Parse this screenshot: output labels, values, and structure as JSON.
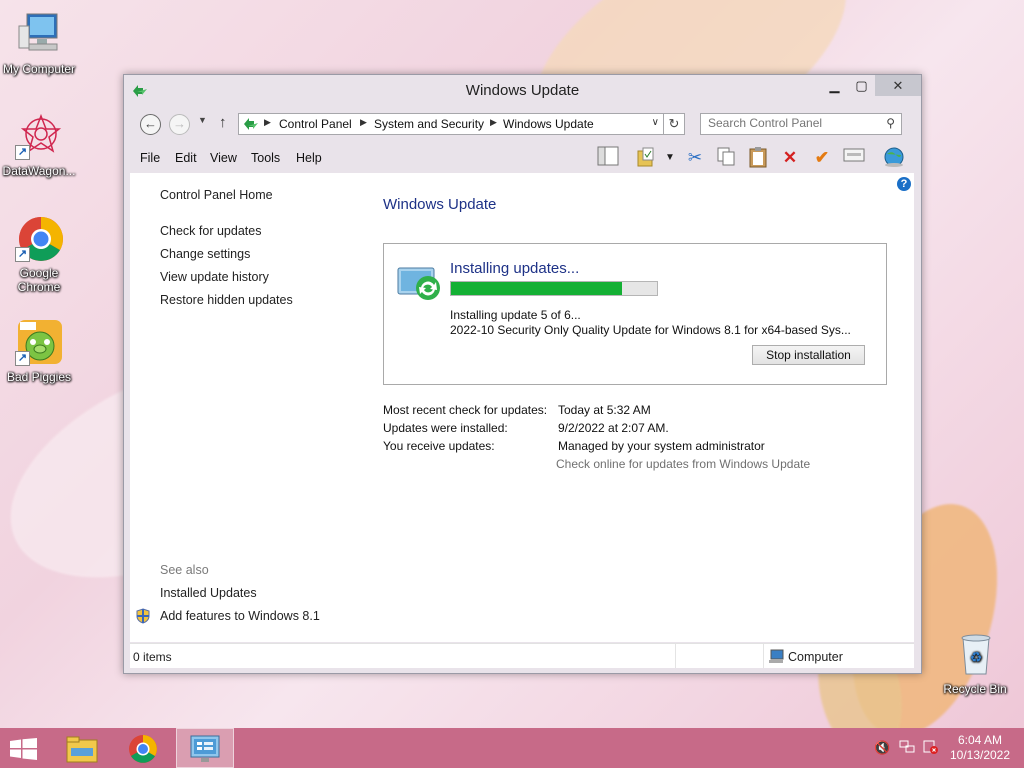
{
  "desktop": {
    "icons": [
      {
        "label": "My Computer"
      },
      {
        "label": "DataWagon..."
      },
      {
        "label": "Google Chrome"
      },
      {
        "label": "Bad Piggies"
      },
      {
        "label": "Recycle Bin"
      }
    ]
  },
  "window": {
    "title": "Windows Update",
    "controls": {
      "minimize": "▁",
      "maximize": "▢",
      "close": "✕"
    }
  },
  "address": {
    "breadcrumbs": [
      "Control Panel",
      "System and Security",
      "Windows Update"
    ],
    "search_placeholder": "Search Control Panel"
  },
  "menu": [
    "File",
    "Edit",
    "View",
    "Tools",
    "Help"
  ],
  "toolbar_icons": [
    "layout-icon",
    "folder-icon",
    "dropdown-icon",
    "cut-icon",
    "copy-icon",
    "paste-icon",
    "delete-icon",
    "checkmark-icon",
    "properties-icon",
    "globe-icon"
  ],
  "sidebar": {
    "home": "Control Panel Home",
    "links": [
      "Check for updates",
      "Change settings",
      "View update history",
      "Restore hidden updates"
    ],
    "see_also_label": "See also",
    "see_also": [
      "Installed Updates",
      "Add features to Windows 8.1"
    ]
  },
  "main": {
    "heading": "Windows Update",
    "status_title": "Installing updates...",
    "progress_fraction": 0.83,
    "progress_text": "Installing update 5 of 6...",
    "update_name": "2022-10 Security Only Quality Update for Windows 8.1 for x64-based Sys...",
    "stop_button": "Stop installation",
    "info": [
      {
        "label": "Most recent check for updates:",
        "value": "Today at 5:32 AM"
      },
      {
        "label": "Updates were installed:",
        "value": "9/2/2022 at 2:07 AM."
      },
      {
        "label": "You receive updates:",
        "value": "Managed by your system administrator"
      }
    ],
    "online_link": "Check online for updates from Windows Update"
  },
  "statusbar": {
    "items": "0 items",
    "location": "Computer"
  },
  "taskbar": {
    "time": "6:04 AM",
    "date": "10/13/2022"
  },
  "colors": {
    "accent": "#1e3287",
    "progress": "#14b034",
    "taskbar": "#c76a88"
  }
}
